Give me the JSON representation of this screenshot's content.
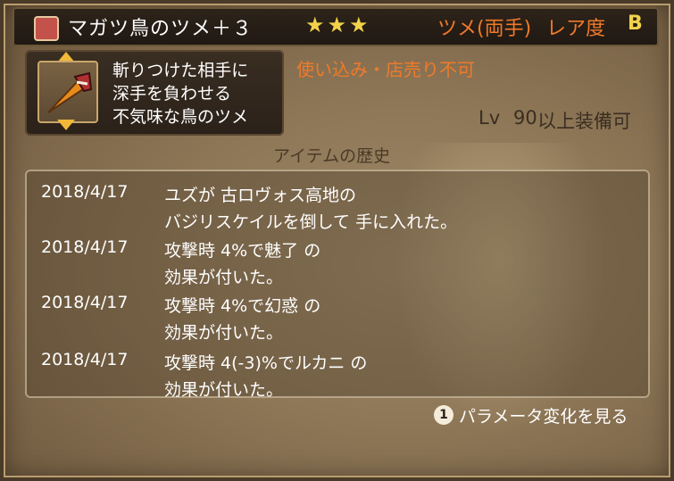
{
  "item": {
    "name": "マガツ鳥のツメ＋３",
    "stars": "★★★",
    "category": "ツメ(両手)",
    "rarity_label": "レア度",
    "rarity": "B",
    "description": [
      "斬りつけた相手に",
      "深手を負わせる",
      "不気味な鳥のツメ"
    ],
    "warning": "使い込み・店売り不可",
    "level_label": "Lv",
    "level_value": "90",
    "level_suffix": "以上装備可"
  },
  "history": {
    "heading": "アイテムの歴史",
    "entries": [
      {
        "date": "2018/4/17",
        "lines": [
          "ユズが 古ロヴォス高地の",
          "バジリスケイルを倒して 手に入れた。"
        ]
      },
      {
        "date": "2018/4/17",
        "lines": [
          "攻撃時 4%で魅了 の",
          "効果が付いた。"
        ]
      },
      {
        "date": "2018/4/17",
        "lines": [
          "攻撃時 4%で幻惑 の",
          "効果が付いた。"
        ]
      },
      {
        "date": "2018/4/17",
        "lines": [
          "攻撃時 4(-3)%でルカニ の",
          "効果が付いた。"
        ]
      }
    ]
  },
  "footer": {
    "button_glyph": "1",
    "param_label": "パラメータ変化を見る"
  }
}
